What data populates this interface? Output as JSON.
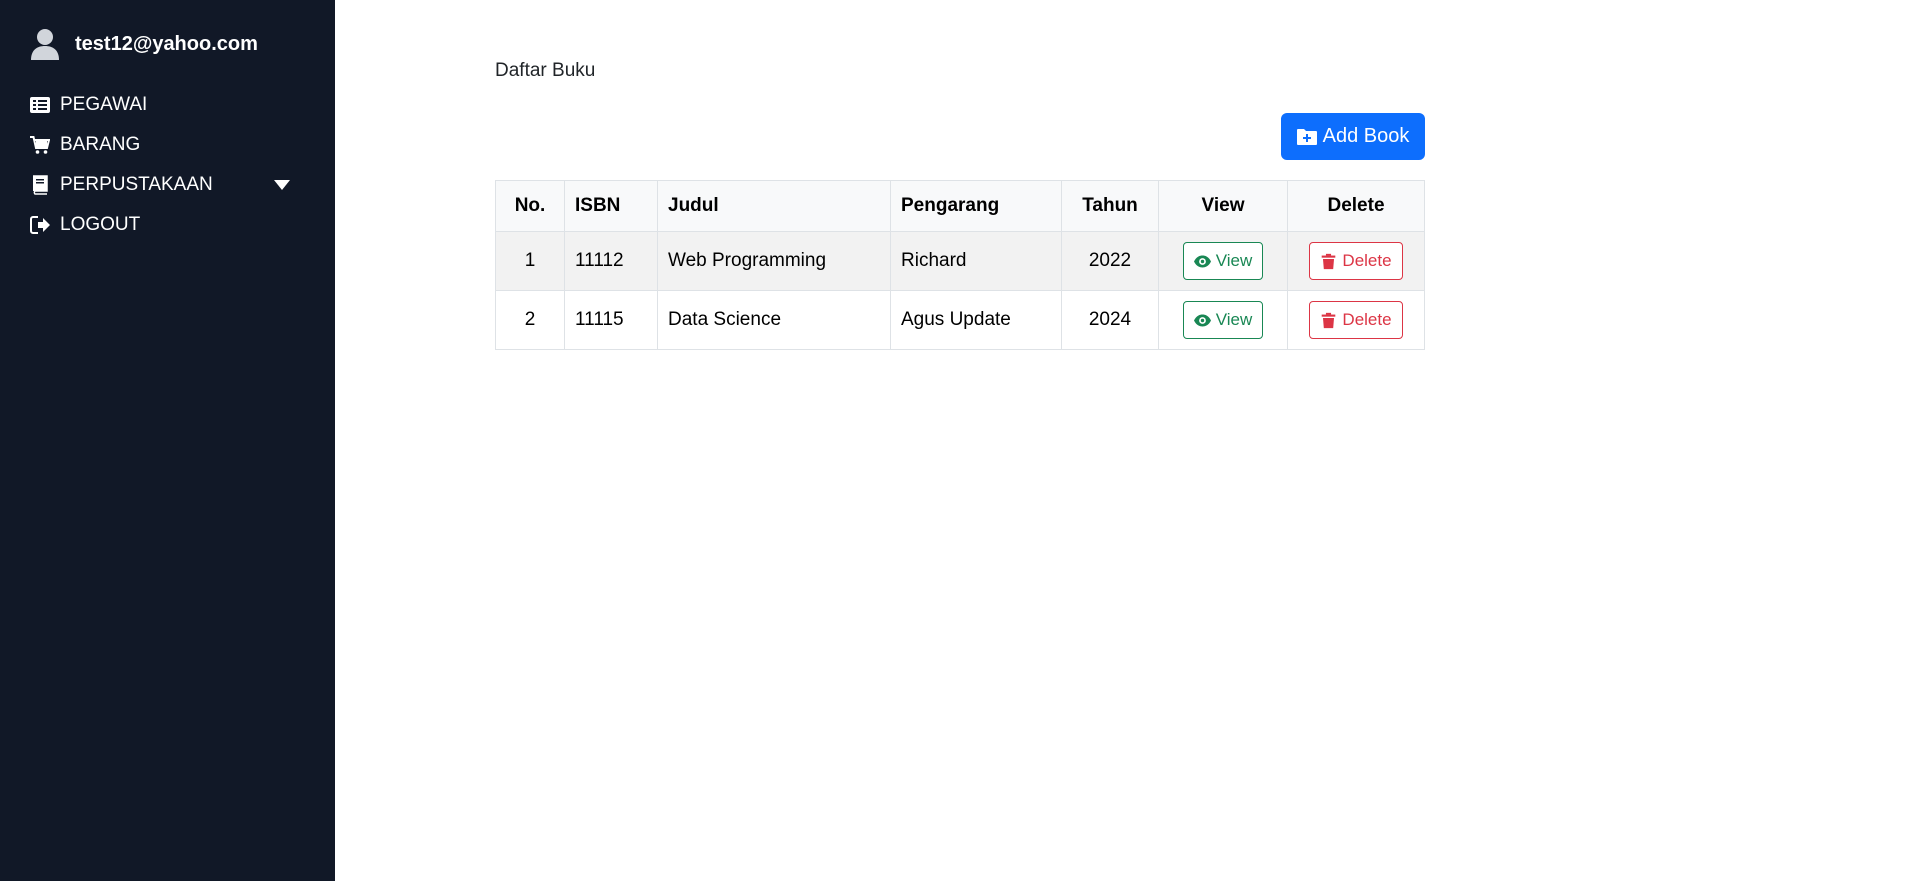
{
  "sidebar": {
    "user_email": "test12@yahoo.com",
    "items": [
      {
        "label": "PEGAWAI",
        "icon": "list-icon"
      },
      {
        "label": "BARANG",
        "icon": "cart-icon"
      },
      {
        "label": "PERPUSTAKAAN",
        "icon": "book-icon",
        "has_dropdown": true
      },
      {
        "label": "LOGOUT",
        "icon": "logout-icon"
      }
    ]
  },
  "main": {
    "heading": "Daftar Buku",
    "add_button_label": "Add Book",
    "table": {
      "headers": [
        "No.",
        "ISBN",
        "Judul",
        "Pengarang",
        "Tahun",
        "View",
        "Delete"
      ],
      "rows": [
        {
          "no": "1",
          "isbn": "11112",
          "judul": "Web Programming",
          "pengarang": "Richard",
          "tahun": "2022",
          "view_label": "View",
          "delete_label": "Delete"
        },
        {
          "no": "2",
          "isbn": "11115",
          "judul": "Data Science",
          "pengarang": "Agus Update",
          "tahun": "2024",
          "view_label": "View",
          "delete_label": "Delete"
        }
      ]
    }
  },
  "colors": {
    "sidebar_bg": "#111827",
    "primary": "#0d6efd",
    "success": "#198754",
    "danger": "#dc3545"
  }
}
